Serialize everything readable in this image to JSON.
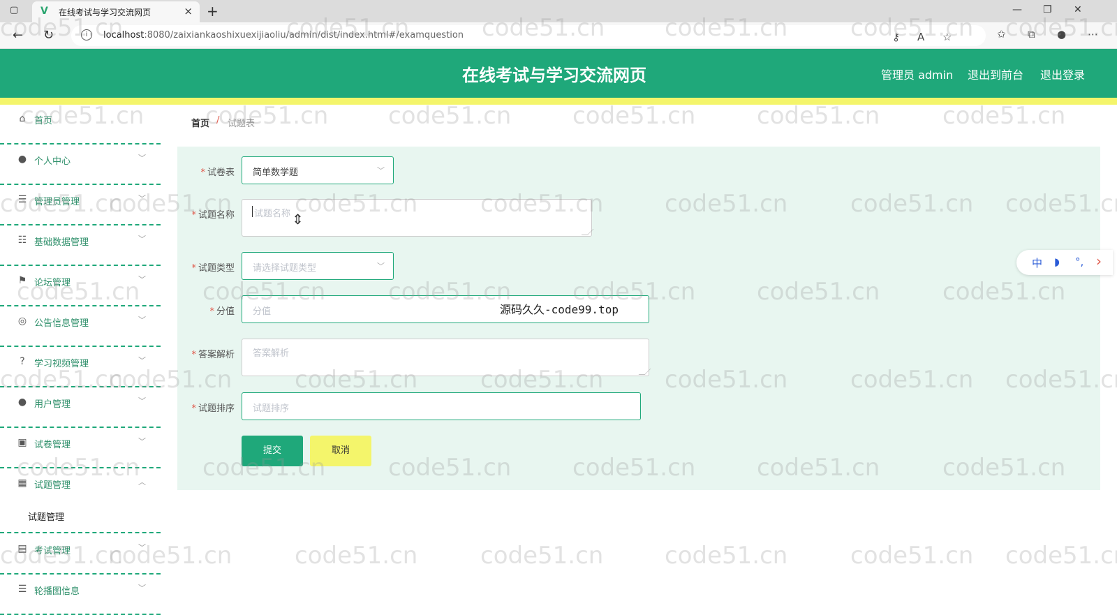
{
  "browser": {
    "tab_title": "在线考试与学习交流网页",
    "tab_close": "×",
    "new_tab": "+",
    "url_host": "localhost",
    "url_path": ":8080/zaixiankaoshixuexijiaoliu/admin/dist/index.html#/examquestion"
  },
  "header": {
    "title": "在线考试与学习交流网页",
    "admin_label": "管理员 admin",
    "frontend_link": "退出到前台",
    "logout_link": "退出登录"
  },
  "sidebar": {
    "items": [
      {
        "label": "首页",
        "icon": "home-icon"
      },
      {
        "label": "个人中心",
        "icon": "user-icon"
      },
      {
        "label": "管理员管理",
        "icon": "list-icon"
      },
      {
        "label": "基础数据管理",
        "icon": "sliders-icon"
      },
      {
        "label": "论坛管理",
        "icon": "flag-icon"
      },
      {
        "label": "公告信息管理",
        "icon": "compass-icon"
      },
      {
        "label": "学习视频管理",
        "icon": "help-icon"
      },
      {
        "label": "用户管理",
        "icon": "user-icon"
      },
      {
        "label": "试卷管理",
        "icon": "clipboard-icon"
      },
      {
        "label": "试题管理",
        "icon": "grid-icon"
      }
    ],
    "submenu": {
      "label": "试题管理"
    },
    "after": [
      {
        "label": "考试管理",
        "icon": "printer-icon"
      },
      {
        "label": "轮播图信息",
        "icon": "list-icon"
      }
    ]
  },
  "breadcrumb": {
    "home": "首页",
    "separator": "/",
    "current": "试题表"
  },
  "form": {
    "paper_label": "试卷表",
    "paper_value": "简单数学题",
    "name_label": "试题名称",
    "name_placeholder": "试题名称",
    "type_label": "试题类型",
    "type_placeholder": "请选择试题类型",
    "score_label": "分值",
    "score_placeholder": "分值",
    "analysis_label": "答案解析",
    "analysis_placeholder": "答案解析",
    "order_label": "试题排序",
    "order_placeholder": "试题排序",
    "submit": "提交",
    "cancel": "取消",
    "required_mark": "*"
  },
  "overlay_text": "源码久久-code99.top",
  "float_toolbar": [
    "中",
    "◗",
    "°,",
    "›"
  ],
  "watermark": "code51.cn",
  "colors": {
    "primary": "#1fa87a",
    "accent_yellow": "#f4f56b",
    "panel_bg": "#e8f6f0"
  }
}
